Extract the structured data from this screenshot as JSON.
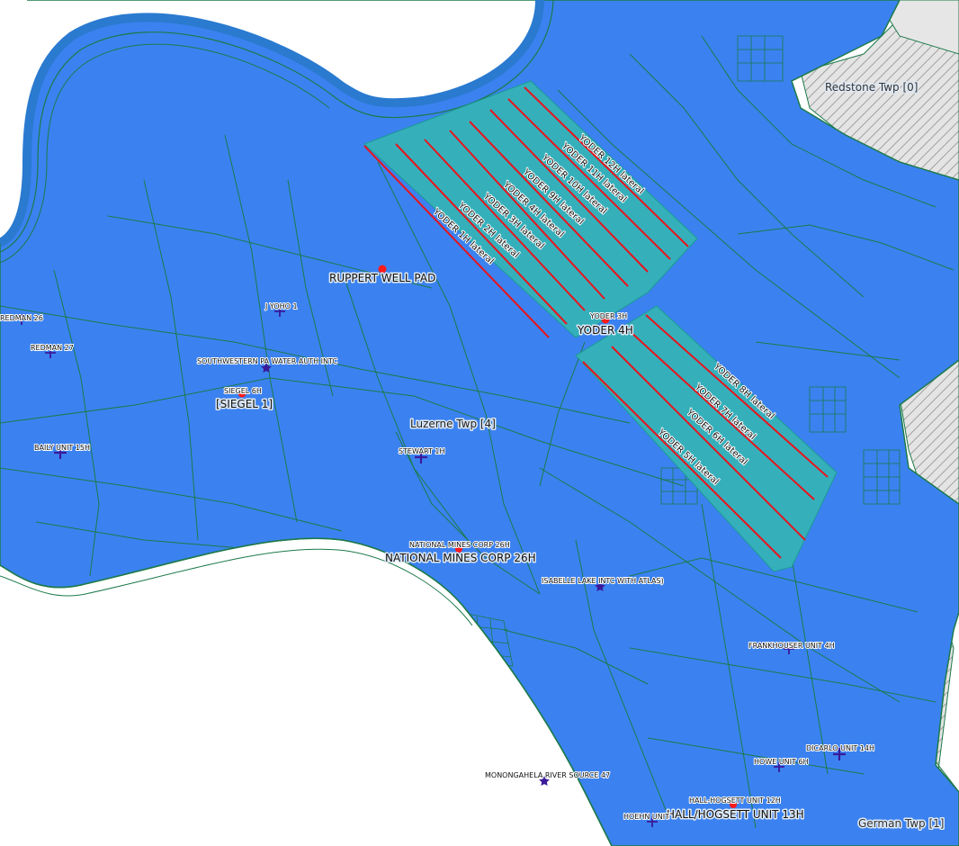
{
  "map": {
    "colors": {
      "township_fill": "#3b82f0",
      "township_border": "#1c7a4a",
      "river": "#2a7ad0",
      "lateral_buffer": "#35b8b2",
      "lateral_line": "#e8141c",
      "well_pad": "#ff1a1a",
      "well_marker": "#3a1a9a",
      "neighbor_hatch": "#b8b8b8"
    },
    "townships": [
      {
        "name": "Redstone Twp [0]"
      },
      {
        "name": "Luzerne Twp [4]"
      },
      {
        "name": "German Twp [1]"
      }
    ],
    "well_pads": [
      {
        "name": "RUPPERT WELL PAD"
      },
      {
        "name": "YODER 4H"
      },
      {
        "name": "[SIEGEL 1]"
      },
      {
        "name": "NATIONAL MINES CORP 26H"
      },
      {
        "name": "HALL/HOGSETT UNIT 13H"
      }
    ],
    "wells": [
      {
        "name": "REDMAN 26"
      },
      {
        "name": "REDMAN 27"
      },
      {
        "name": "J YOHO 1"
      },
      {
        "name": "SOUTHWESTERN PA WATER AUTH INTC"
      },
      {
        "name": "SIEGEL 6H"
      },
      {
        "name": "BAILY UNIT 15H"
      },
      {
        "name": "STEWART 1H"
      },
      {
        "name": "YODER 3H"
      },
      {
        "name": "NATIONAL MINES CORP 26H"
      },
      {
        "name": "ISABELLE LAKE INTC WITH ATLAS)"
      },
      {
        "name": "FRANKHOUSER UNIT 4H"
      },
      {
        "name": "DICARLO UNIT 14H"
      },
      {
        "name": "HOWE UNIT 6H"
      },
      {
        "name": "MONONGAHELA RIVER SOURCE 47"
      },
      {
        "name": "HALL-HOGSETT UNIT 12H"
      },
      {
        "name": "HOEHN UNIT"
      }
    ],
    "laterals": [
      {
        "name": "YODER 12H lateral"
      },
      {
        "name": "YODER 11H lateral"
      },
      {
        "name": "YODER 10H lateral"
      },
      {
        "name": "YODER 9H lateral"
      },
      {
        "name": "YODER 4H lateral"
      },
      {
        "name": "YODER 3H lateral"
      },
      {
        "name": "YODER 2H lateral"
      },
      {
        "name": "YODER 1H lateral"
      },
      {
        "name": "YODER 8H lateral"
      },
      {
        "name": "YODER 7H lateral"
      },
      {
        "name": "YODER 6H lateral"
      },
      {
        "name": "YODER 5H lateral"
      }
    ]
  }
}
